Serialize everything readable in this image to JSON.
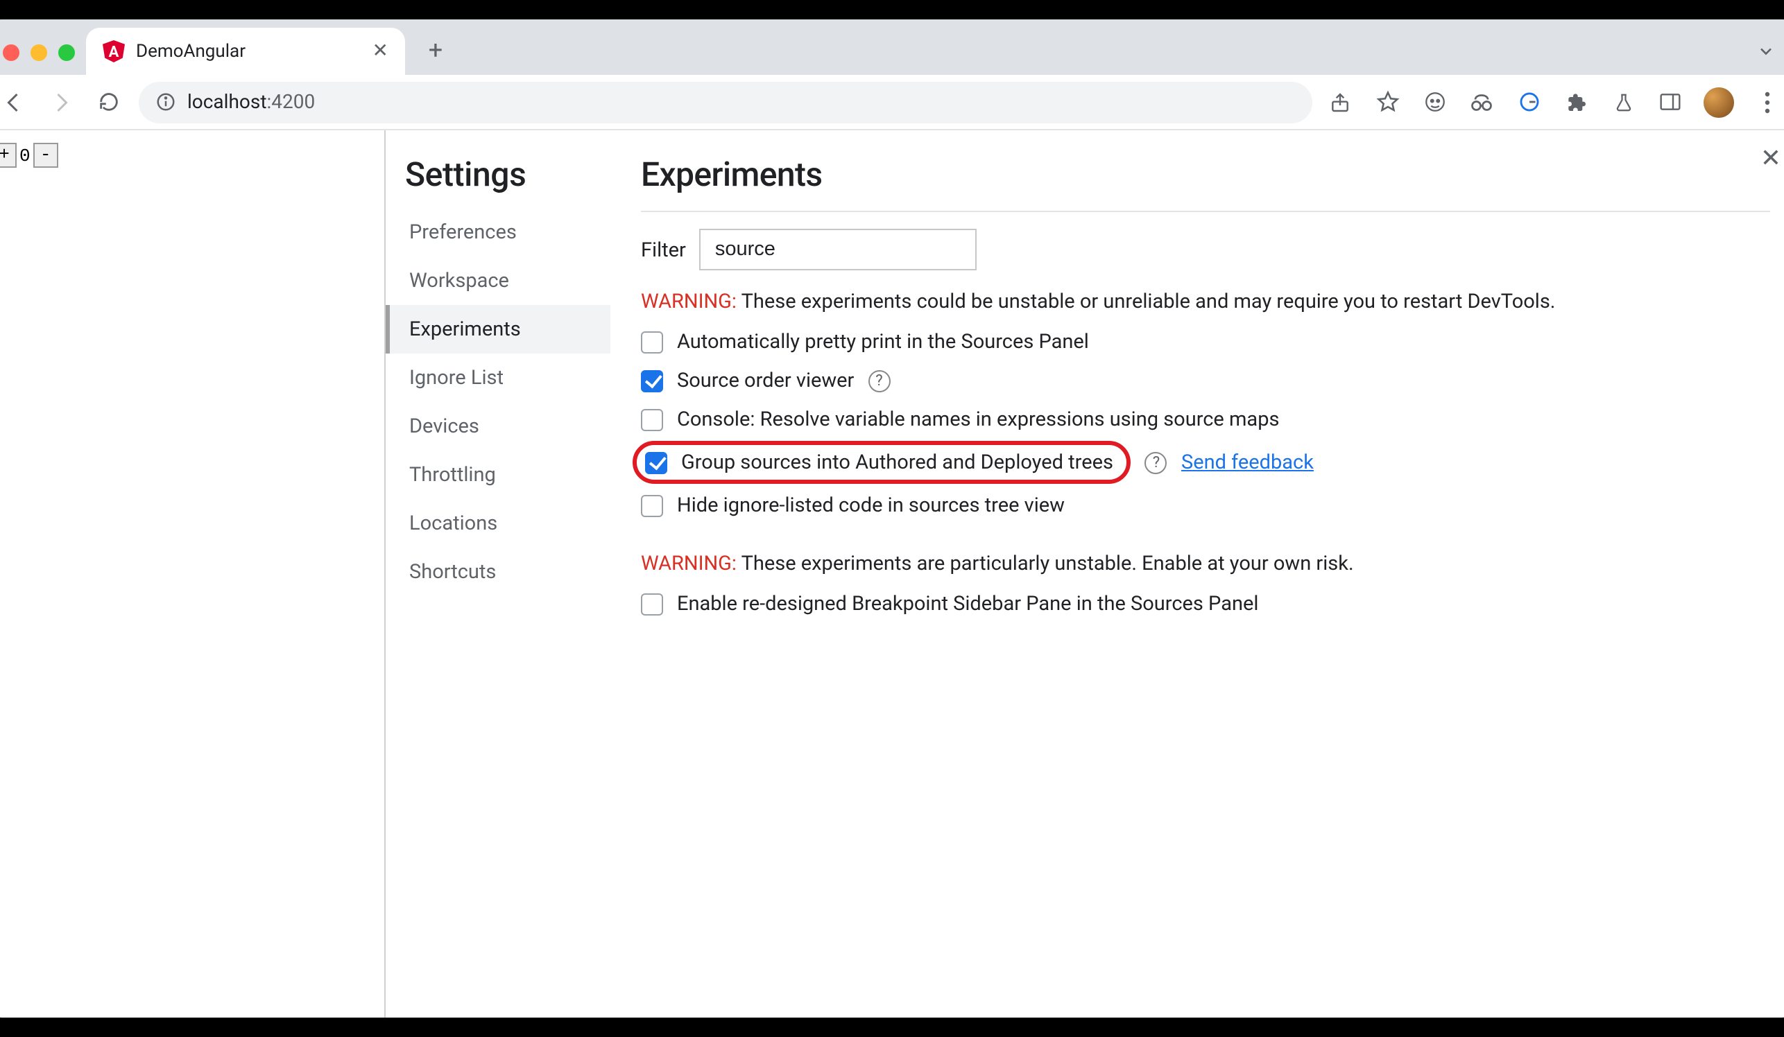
{
  "tab": {
    "title": "DemoAngular",
    "favicon_letter": "A"
  },
  "url": {
    "host": "localhost",
    "port": ":4200",
    "info_icon": "info"
  },
  "left": {
    "btn_plus": "+",
    "btn_minus": "-",
    "value": "0"
  },
  "settings": {
    "title": "Settings",
    "items": [
      {
        "label": "Preferences"
      },
      {
        "label": "Workspace"
      },
      {
        "label": "Experiments"
      },
      {
        "label": "Ignore List"
      },
      {
        "label": "Devices"
      },
      {
        "label": "Throttling"
      },
      {
        "label": "Locations"
      },
      {
        "label": "Shortcuts"
      }
    ],
    "active_index": 2
  },
  "experiments": {
    "title": "Experiments",
    "filter_label": "Filter",
    "filter_value": "source",
    "warning1_prefix": "WARNING:",
    "warning1_text": " These experiments could be unstable or unreliable and may require you to restart DevTools.",
    "options": [
      {
        "label": "Automatically pretty print in the Sources Panel",
        "checked": false,
        "help": false
      },
      {
        "label": "Source order viewer",
        "checked": true,
        "help": true
      },
      {
        "label": "Console: Resolve variable names in expressions using source maps",
        "checked": false,
        "help": false
      },
      {
        "label": "Group sources into Authored and Deployed trees",
        "checked": true,
        "help": true,
        "highlight": true,
        "feedback": "Send feedback"
      },
      {
        "label": "Hide ignore-listed code in sources tree view",
        "checked": false,
        "help": false
      }
    ],
    "warning2_prefix": "WARNING:",
    "warning2_text": " These experiments are particularly unstable. Enable at your own risk.",
    "options2": [
      {
        "label": "Enable re-designed Breakpoint Sidebar Pane in the Sources Panel",
        "checked": false
      }
    ]
  }
}
